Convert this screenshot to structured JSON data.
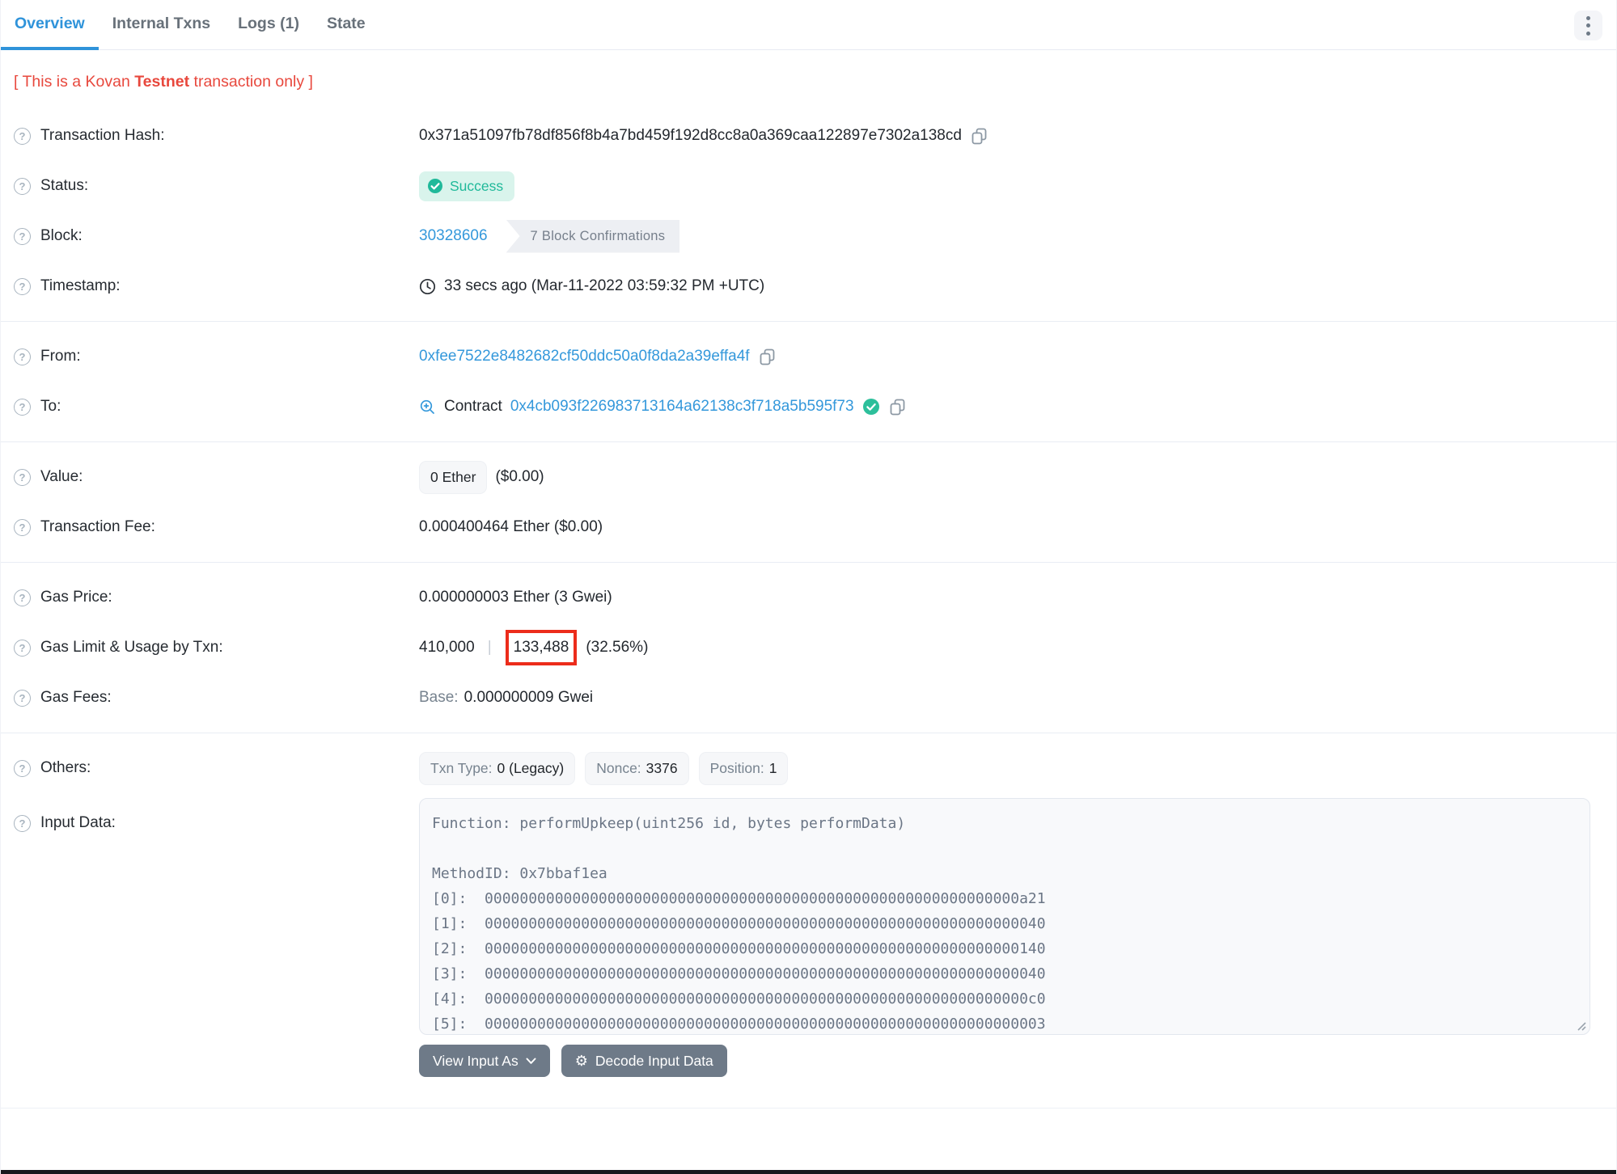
{
  "tabs": [
    {
      "label": "Overview",
      "active": true
    },
    {
      "label": "Internal Txns",
      "active": false
    },
    {
      "label": "Logs (1)",
      "active": false
    },
    {
      "label": "State",
      "active": false
    }
  ],
  "notice": {
    "pre": "[ This is a Kovan ",
    "bold": "Testnet",
    "post": " transaction only ]"
  },
  "rows": {
    "tx_hash": {
      "label": "Transaction Hash:",
      "value": "0x371a51097fb78df856f8b4a7bd459f192d8cc8a0a369caa122897e7302a138cd"
    },
    "status": {
      "label": "Status:",
      "badge": "Success"
    },
    "block": {
      "label": "Block:",
      "number": "30328606",
      "confirmations": "7 Block Confirmations"
    },
    "timestamp": {
      "label": "Timestamp:",
      "value": "33 secs ago (Mar-11-2022 03:59:32 PM +UTC)"
    },
    "from": {
      "label": "From:",
      "address": "0xfee7522e8482682cf50ddc50a0f8da2a39effa4f"
    },
    "to": {
      "label": "To:",
      "contract_word": "Contract",
      "address": "0x4cb093f226983713164a62138c3f718a5b595f73"
    },
    "value": {
      "label": "Value:",
      "badge": "0 Ether",
      "usd": "($0.00)"
    },
    "tx_fee": {
      "label": "Transaction Fee:",
      "value": "0.000400464 Ether ($0.00)"
    },
    "gas_price": {
      "label": "Gas Price:",
      "value": "0.000000003 Ether (3 Gwei)"
    },
    "gas_limit": {
      "label": "Gas Limit & Usage by Txn:",
      "limit": "410,000",
      "separator": "|",
      "used": "133,488",
      "percent": "(32.56%)"
    },
    "gas_fees": {
      "label": "Gas Fees:",
      "base_label": "Base:",
      "base_value": "0.000000009 Gwei"
    },
    "others": {
      "label": "Others:",
      "badges": [
        {
          "k": "Txn Type:",
          "v": "0 (Legacy)"
        },
        {
          "k": "Nonce:",
          "v": "3376"
        },
        {
          "k": "Position:",
          "v": "1"
        }
      ]
    },
    "input_data": {
      "label": "Input Data:",
      "lines": [
        "Function: performUpkeep(uint256 id, bytes performData)",
        "",
        "MethodID: 0x7bbaf1ea",
        "[0]:  0000000000000000000000000000000000000000000000000000000000000a21",
        "[1]:  0000000000000000000000000000000000000000000000000000000000000040",
        "[2]:  0000000000000000000000000000000000000000000000000000000000000140",
        "[3]:  0000000000000000000000000000000000000000000000000000000000000040",
        "[4]:  00000000000000000000000000000000000000000000000000000000000000c0",
        "[5]:  0000000000000000000000000000000000000000000000000000000000000003"
      ]
    }
  },
  "buttons": {
    "view_input_as": "View Input As",
    "decode": "Decode Input Data"
  },
  "icons": {
    "kebab": "vertical-ellipsis",
    "gear": "⚙"
  },
  "colors": {
    "accent_blue": "#3498db",
    "success_text": "#20b99a",
    "success_bg": "#d9f4ec",
    "notice_red": "#e8483d",
    "highlight_box_red": "#ec2c1b"
  }
}
